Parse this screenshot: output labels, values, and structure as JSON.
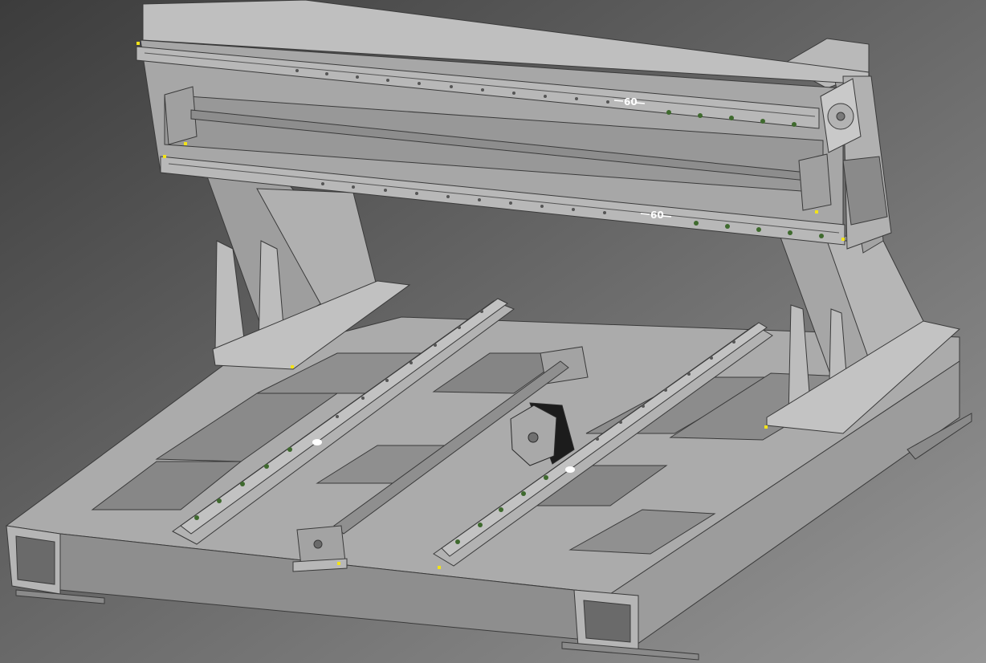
{
  "colors": {
    "bg_top": "#3f3f3f",
    "bg_bottom": "#8e8e8e",
    "metal_light": "#c4c4c4",
    "metal_mid": "#a9a9a9",
    "metal_dark": "#7e7e7e",
    "edge": "#3a3a3a",
    "bolt_green": "#3f6a2e",
    "marker_yellow": "#f2e318",
    "motor_dark": "#1c1c1c"
  },
  "annotations": {
    "upper_rail_dimension": "60",
    "lower_rail_dimension": "60"
  }
}
